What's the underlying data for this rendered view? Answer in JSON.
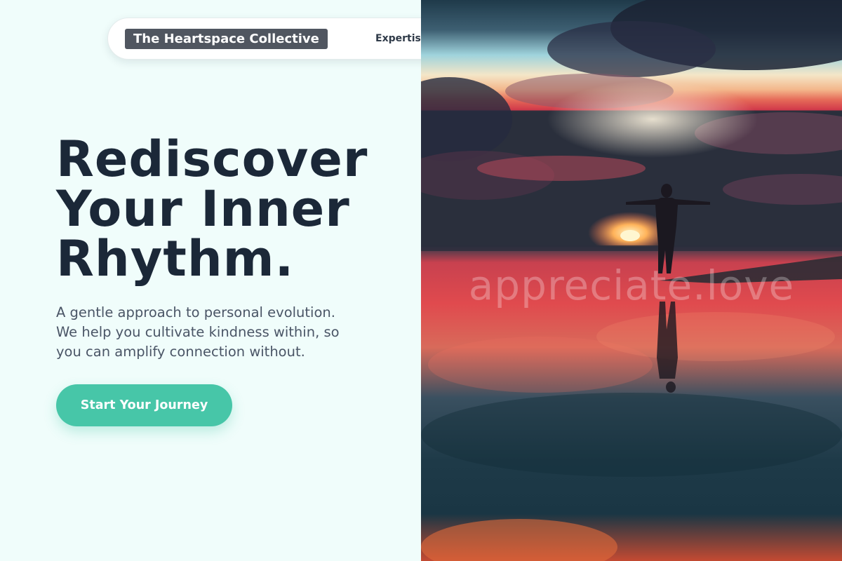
{
  "nav": {
    "brand": "The Heartspace Collective",
    "links": [
      "Expertis"
    ]
  },
  "hero": {
    "title_lines": [
      "Rediscover",
      "Your Inner",
      "Rhythm."
    ],
    "subtitle_lines": [
      "A gentle approach to personal evolution.",
      "We help you cultivate kindness within, so",
      "you can amplify connection without."
    ],
    "cta_label": "Start Your Journey"
  },
  "image": {
    "watermark": "appreciate.love",
    "icon": "sunset-silhouette-photo"
  },
  "colors": {
    "background": "#f0fdfb",
    "heading": "#1b2838",
    "body_text": "#4a5566",
    "accent": "#47c6a8",
    "brand_bg": "#505660"
  }
}
